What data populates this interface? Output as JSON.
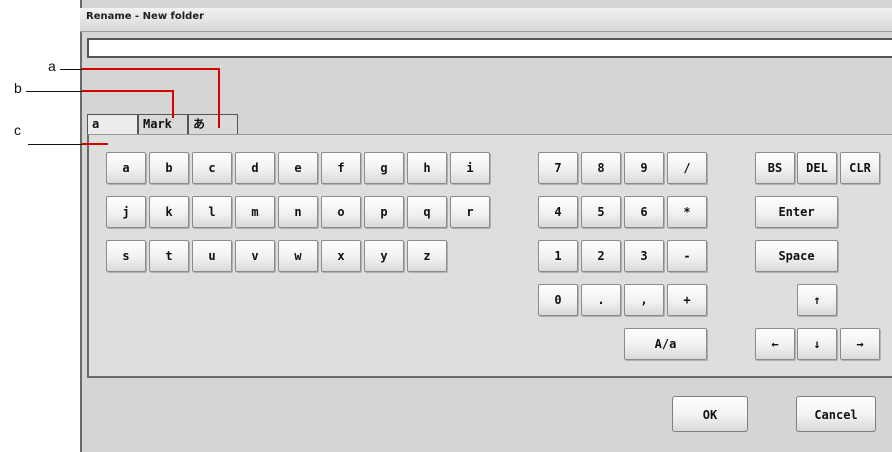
{
  "dialog": {
    "title": "Rename - New folder",
    "input_value": ""
  },
  "callouts": {
    "a": "a",
    "b": "b",
    "c": "c"
  },
  "tabs": [
    "a",
    "Mark",
    "あ"
  ],
  "letters": {
    "row1": [
      "a",
      "b",
      "c",
      "d",
      "e",
      "f",
      "g",
      "h",
      "i"
    ],
    "row2": [
      "j",
      "k",
      "l",
      "m",
      "n",
      "o",
      "p",
      "q",
      "r"
    ],
    "row3": [
      "s",
      "t",
      "u",
      "v",
      "w",
      "x",
      "y",
      "z"
    ]
  },
  "numpad": {
    "row1": [
      "7",
      "8",
      "9",
      "/"
    ],
    "row2": [
      "4",
      "5",
      "6",
      "*"
    ],
    "row3": [
      "1",
      "2",
      "3",
      "-"
    ],
    "row4": [
      "0",
      ".",
      ",",
      "+"
    ],
    "toggle": "A/a"
  },
  "edit_keys": {
    "bs": "BS",
    "del": "DEL",
    "clr": "CLR",
    "enter": "Enter",
    "space": "Space",
    "up": "↑",
    "left": "←",
    "down": "↓",
    "right": "→"
  },
  "footer": {
    "ok": "OK",
    "cancel": "Cancel"
  }
}
